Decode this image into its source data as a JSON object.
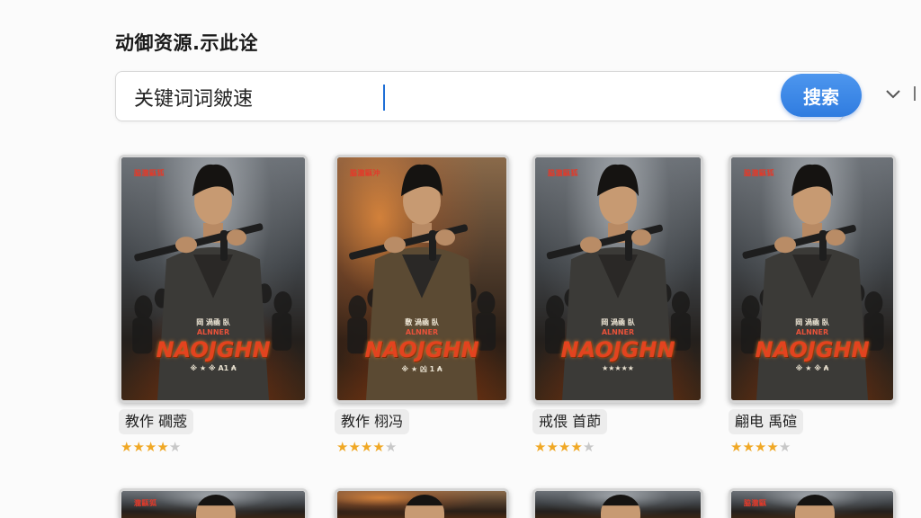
{
  "header": {
    "title": "动御资源.示此诠"
  },
  "search": {
    "value": "关键词词皴速",
    "button_label": "搜索"
  },
  "colors": {
    "accent": "#2f7ce0",
    "star": "#f0a825"
  },
  "movies": [
    {
      "title": "教作 礀蔲",
      "rating": 4,
      "max": 5,
      "poster": {
        "top": "脇瀧甌狐",
        "tag": "岡 渦凾 臥",
        "logo": "NAOJGHN",
        "headline": "ALNNER",
        "sub": "※ ★ ※ A1 ₳"
      }
    },
    {
      "title": "教作 栩冯",
      "rating": 4,
      "max": 5,
      "poster": {
        "top": "脇瀧甌沖",
        "tag": "敷 渦凾 臥",
        "logo": "NAOJGHN",
        "headline": "ALNNER",
        "sub": "※ ★ 凶 1 ₳"
      }
    },
    {
      "title": "戒偎 首莭",
      "rating": 4,
      "max": 5,
      "poster": {
        "top": "脇瀧甌狐",
        "tag": "岡 渦凾 臥",
        "logo": "NAOJGHN",
        "headline": "ALNNER",
        "sub": "★★★★★"
      }
    },
    {
      "title": "翩电 禹碹",
      "rating": 4,
      "max": 5,
      "poster": {
        "top": "脇瀧甌狐",
        "tag": "岡 渦凾 臥",
        "logo": "NAOJGHN",
        "headline": "ALNNER",
        "sub": "※ ★ ※ ₳"
      }
    }
  ],
  "second_row": [
    {
      "poster_top": "瀧甌狐"
    },
    {
      "poster_top": ""
    },
    {
      "poster_top": ""
    },
    {
      "poster_top": "脇瀧甌"
    }
  ]
}
